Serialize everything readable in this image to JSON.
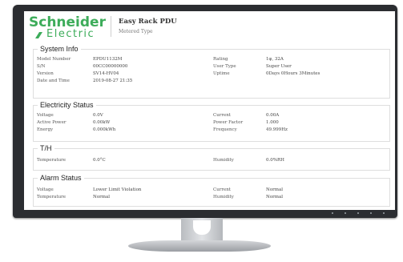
{
  "brand": {
    "name": "Schneider",
    "sub": "Electric"
  },
  "product": {
    "title": "Easy Rack PDU",
    "subtitle": "Metered Type"
  },
  "system_info": {
    "title": "System Info",
    "left": [
      {
        "label": "Model Number",
        "value": "EPDU1132M"
      },
      {
        "label": "S/N",
        "value": "00CC00000000"
      },
      {
        "label": "Version",
        "value": "SV14-HV04"
      },
      {
        "label": "Date and Time",
        "value": "2019-08-27 21:35"
      }
    ],
    "right": [
      {
        "label": "Rating",
        "value": "1φ, 32A"
      },
      {
        "label": "User Type",
        "value": "Super User"
      },
      {
        "label": "Uptime",
        "value": "0Days 0Hours 3Minutes"
      }
    ]
  },
  "electricity_status": {
    "title": "Electricity Status",
    "left": [
      {
        "label": "Voltage",
        "value": "0.0V"
      },
      {
        "label": "Active Power",
        "value": "0.00kW"
      },
      {
        "label": "Energy",
        "value": "0.000kWh"
      }
    ],
    "right": [
      {
        "label": "Current",
        "value": "0.00A"
      },
      {
        "label": "Power Factor",
        "value": "1.000"
      },
      {
        "label": "Frequency",
        "value": "49.999Hz"
      }
    ]
  },
  "th": {
    "title": "T/H",
    "left": [
      {
        "label": "Temperature",
        "value": "0.0°C"
      }
    ],
    "right": [
      {
        "label": "Humidity",
        "value": "0.0%RH"
      }
    ]
  },
  "alarm_status": {
    "title": "Alarm Status",
    "left": [
      {
        "label": "Voltage",
        "value": "Lower Limit Violation"
      },
      {
        "label": "Temperature",
        "value": "Normal"
      }
    ],
    "right": [
      {
        "label": "Current",
        "value": "Normal"
      },
      {
        "label": "Humidity",
        "value": "Normal"
      }
    ]
  },
  "colors": {
    "brand_green": "#3dac5a",
    "bezel": "#2b2d31"
  }
}
